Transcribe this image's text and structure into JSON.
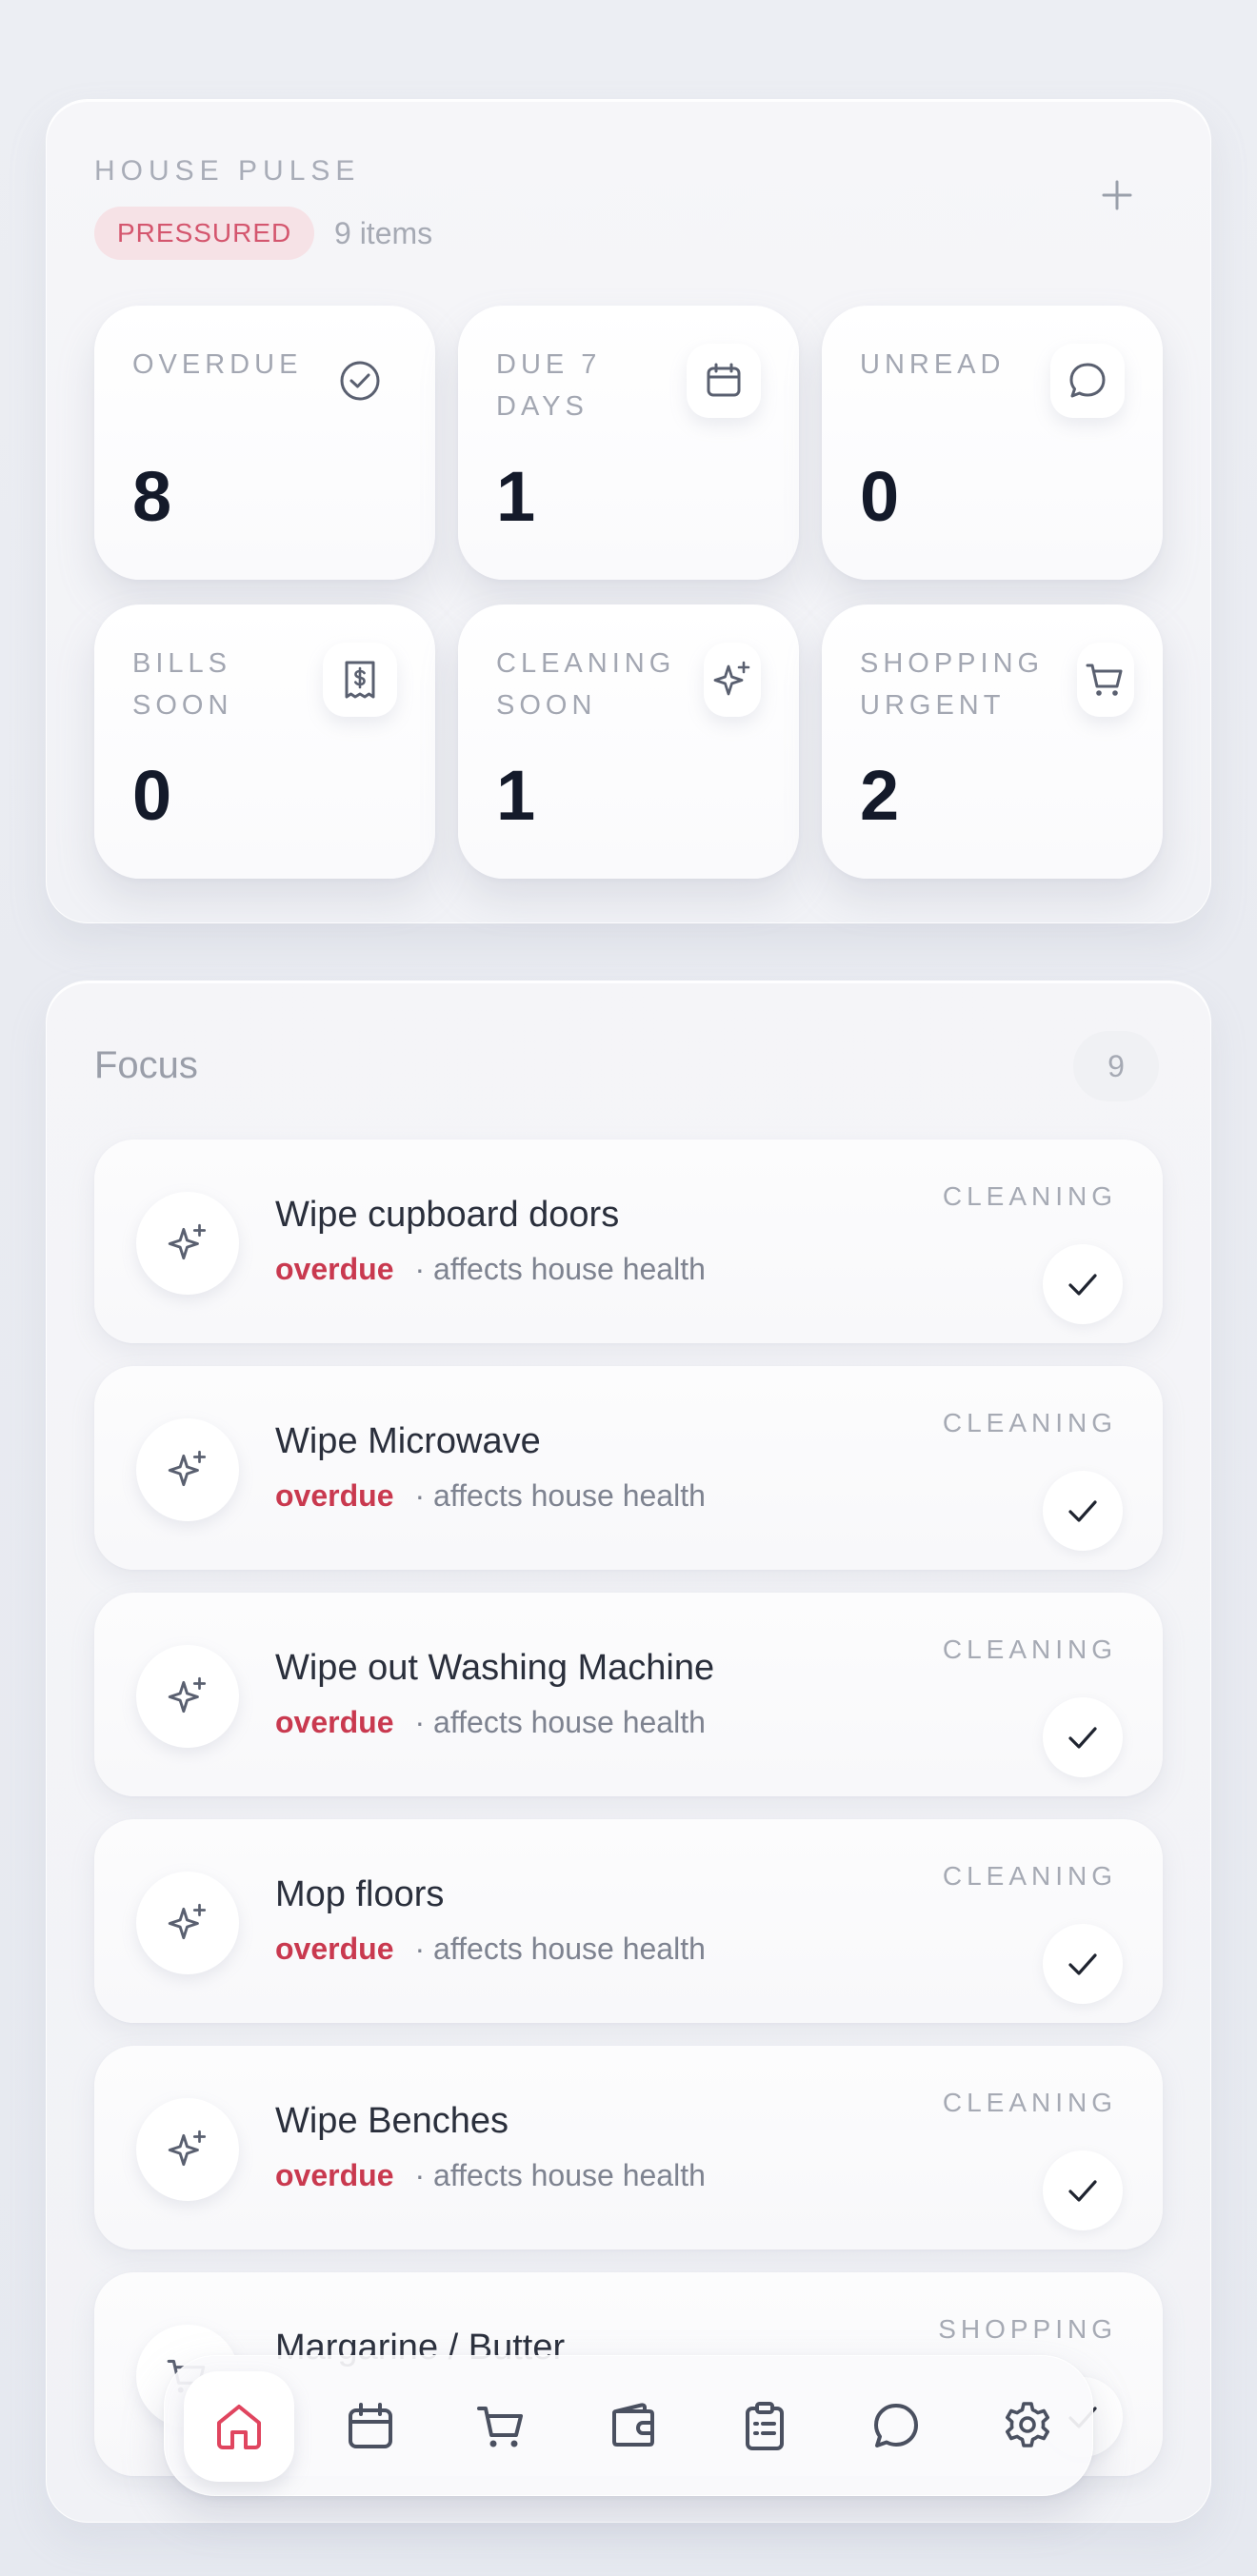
{
  "pulse": {
    "title": "HOUSE PULSE",
    "status": "PRESSURED",
    "items_count": "9 items",
    "tiles": [
      {
        "label": "OVERDUE",
        "value": "8",
        "icon": "check-circle-icon"
      },
      {
        "label": "DUE 7 DAYS",
        "value": "1",
        "icon": "calendar-icon"
      },
      {
        "label": "UNREAD",
        "value": "0",
        "icon": "chat-bubble-icon"
      },
      {
        "label": "BILLS SOON",
        "value": "0",
        "icon": "receipt-dollar-icon"
      },
      {
        "label": "CLEANING SOON",
        "value": "1",
        "icon": "sparkle-icon"
      },
      {
        "label": "SHOPPING URGENT",
        "value": "2",
        "icon": "cart-icon"
      }
    ]
  },
  "focus": {
    "title": "Focus",
    "count": "9",
    "tasks": [
      {
        "title": "Wipe cupboard doors",
        "status": "overdue",
        "note": "· affects house health",
        "category": "CLEANING"
      },
      {
        "title": "Wipe Microwave",
        "status": "overdue",
        "note": "· affects house health",
        "category": "CLEANING"
      },
      {
        "title": "Wipe out Washing Machine",
        "status": "overdue",
        "note": "· affects house health",
        "category": "CLEANING"
      },
      {
        "title": "Mop floors",
        "status": "overdue",
        "note": "· affects house health",
        "category": "CLEANING"
      },
      {
        "title": "Wipe Benches",
        "status": "overdue",
        "note": "· affects house health",
        "category": "CLEANING"
      },
      {
        "title": "Margarine / Butter",
        "status": "",
        "note": "",
        "category": "SHOPPING"
      }
    ]
  },
  "nav": {
    "items": [
      {
        "name": "home",
        "icon": "home-icon",
        "active": true
      },
      {
        "name": "calendar",
        "icon": "calendar-icon"
      },
      {
        "name": "shopping",
        "icon": "cart-icon"
      },
      {
        "name": "wallet",
        "icon": "wallet-icon"
      },
      {
        "name": "tasks",
        "icon": "clipboard-icon"
      },
      {
        "name": "messages",
        "icon": "chat-bubble-icon"
      },
      {
        "name": "settings",
        "icon": "gear-icon"
      }
    ]
  },
  "colors": {
    "accent": "#e0455f",
    "overdue": "#c9394f",
    "status_bg": "#f6e2e6",
    "icon_stroke": "#5a6070"
  }
}
